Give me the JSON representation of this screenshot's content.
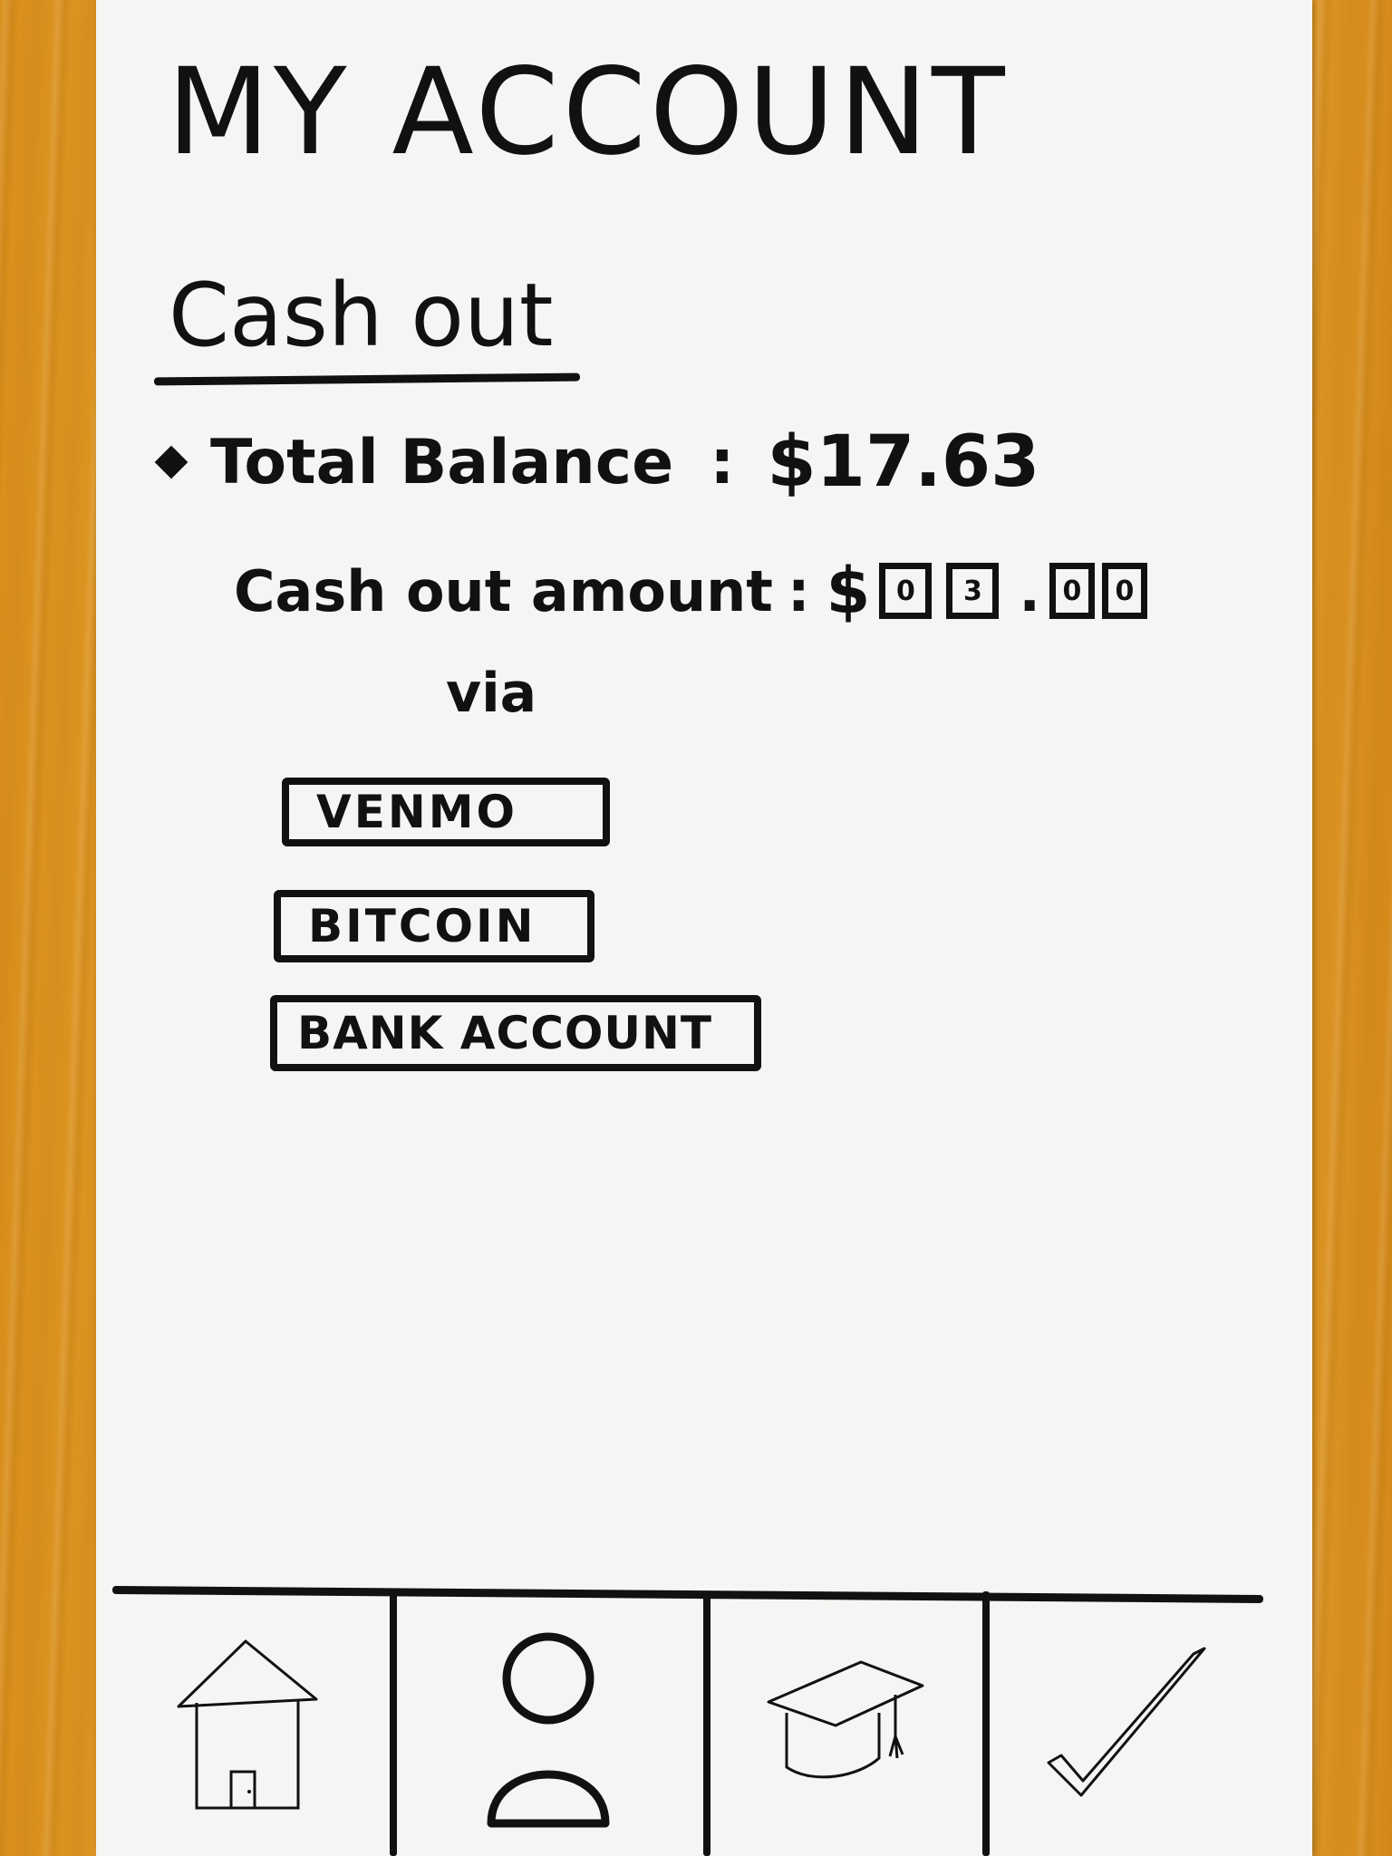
{
  "header": {
    "title": "MY ACCOUNT"
  },
  "cash_out": {
    "section_title": "Cash out",
    "total_balance_label": "Total Balance",
    "total_balance_value": "$17.63",
    "amount_label": "Cash out amount",
    "amount_currency": "$",
    "amount_digits": [
      "0",
      "3",
      "0",
      "0"
    ],
    "via_label": "via"
  },
  "payment_methods": [
    {
      "label": "VENMO"
    },
    {
      "label": "BITCOIN"
    },
    {
      "label": "BANK ACCOUNT"
    }
  ],
  "tab_bar": {
    "items": [
      {
        "icon": "home-icon"
      },
      {
        "icon": "person-icon",
        "selected": true
      },
      {
        "icon": "graduation-cap-icon"
      },
      {
        "icon": "checkmark-icon"
      }
    ]
  },
  "colors": {
    "ink": "#111111",
    "paper": "#f5f5f3",
    "table_wood": "#e2a02c"
  }
}
